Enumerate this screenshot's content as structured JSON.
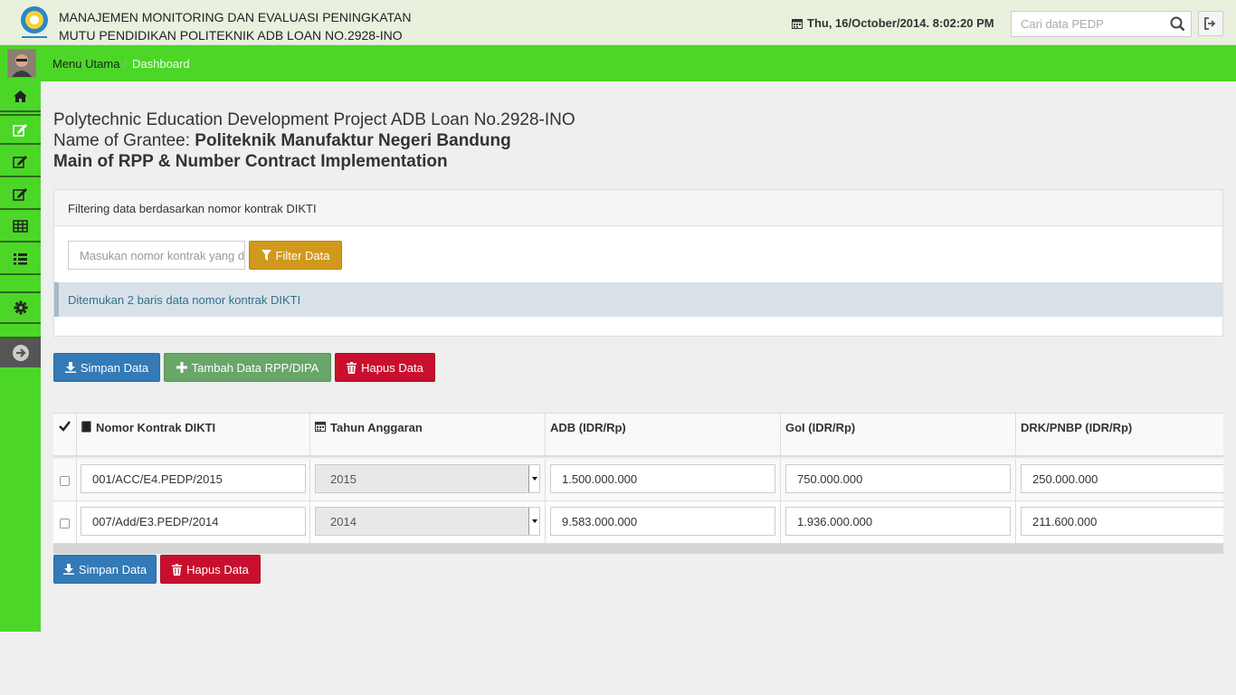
{
  "header": {
    "title_line1": "MANAJEMEN MONITORING DAN EVALUASI PENINGKATAN",
    "title_line2": "MUTU PENDIDIKAN POLITEKNIK ADB LOAN NO.2928-INO",
    "datetime": "Thu, 16/October/2014. 8:02:20 PM",
    "search_placeholder": "Cari data PEDP"
  },
  "breadcrumb": {
    "home": "Menu Utama",
    "separator": "/",
    "current": "Dashboard"
  },
  "sidebar": {
    "items": [
      "home-icon",
      "edit-icon",
      "edit-icon",
      "edit-icon",
      "table-icon",
      "list-icon",
      "gear-icon",
      "arrow-right-circle-icon"
    ]
  },
  "page": {
    "line1": "Polytechnic Education Development Project ADB Loan No.2928-INO",
    "line2_prefix": "Name of Grantee: ",
    "line2_name": "Politeknik Manufaktur Negeri Bandung",
    "line3": "Main of RPP & Number Contract Implementation"
  },
  "filter": {
    "heading": "Filtering data berdasarkan nomor kontrak DIKTI",
    "placeholder": "Masukan nomor kontrak yang dicari",
    "button": "Filter Data",
    "result": "Ditemukan 2 baris data nomor kontrak DIKTI"
  },
  "actions": {
    "save": "Simpan Data",
    "add": "Tambah Data RPP/DIPA",
    "delete": "Hapus Data"
  },
  "table": {
    "headers": [
      "Nomor Kontrak DIKTI",
      "Tahun Anggaran",
      "ADB (IDR/Rp)",
      "GoI (IDR/Rp)",
      "DRK/PNBP (IDR/Rp)"
    ],
    "rows": [
      {
        "kontrak": "001/ACC/E4.PEDP/2015",
        "tahun": "2015",
        "adb": "1.500.000.000",
        "goi": "750.000.000",
        "drk": "250.000.000"
      },
      {
        "kontrak": "007/Add/E3.PEDP/2014",
        "tahun": "2014",
        "adb": "9.583.000.000",
        "goi": "1.936.000.000",
        "drk": "211.600.000"
      }
    ]
  },
  "bottom_actions": {
    "save": "Simpan Data",
    "delete": "Hapus Data"
  },
  "colors": {
    "green": "#4cd728",
    "primary": "#337ab7",
    "success": "#6aa56a",
    "danger": "#c8102e",
    "warning": "#d1991c"
  }
}
